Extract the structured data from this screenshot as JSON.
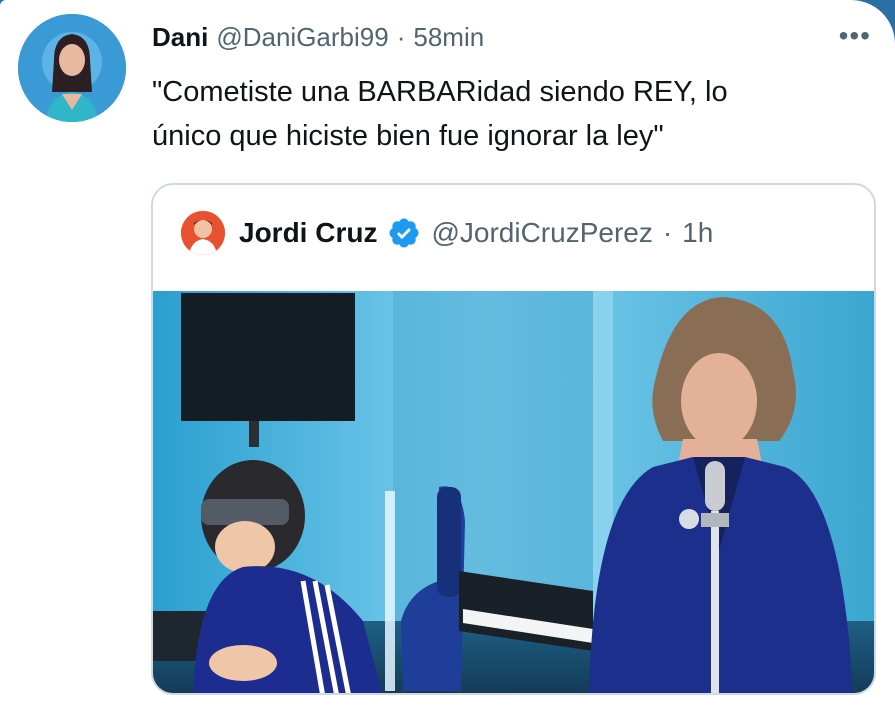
{
  "tweet": {
    "display_name": "Dani",
    "handle": "@DaniGarbi99",
    "separator": "·",
    "time": "58min",
    "more_icon": "more-horizontal-icon",
    "text_line1": "\"Cometiste una BARBARidad siendo REY, lo",
    "text_line2": "único que hiciste bien fue ignorar la ley\""
  },
  "quote": {
    "display_name": "Jordi Cruz",
    "verified_icon": "verified-badge-icon",
    "handle": "@JordiCruzPerez",
    "separator": "·",
    "time": "1h"
  },
  "colors": {
    "text_primary": "#0f1419",
    "text_secondary": "#536471",
    "verified_blue": "#1d9bf0",
    "border": "#cfd9de"
  }
}
